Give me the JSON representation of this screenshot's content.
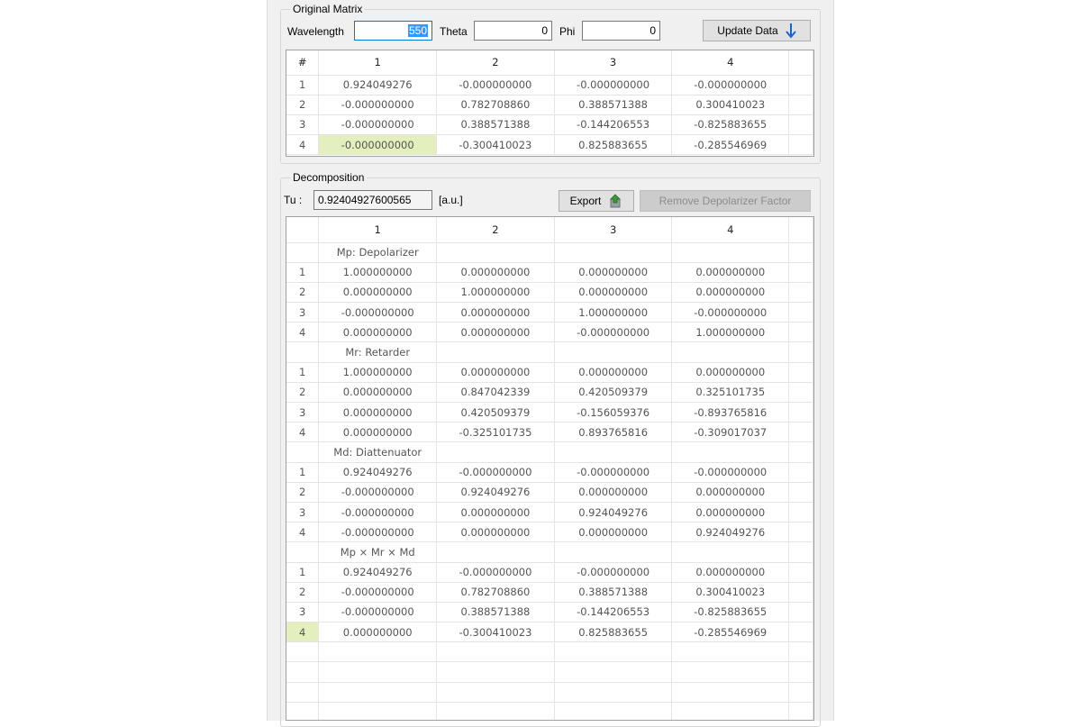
{
  "original": {
    "group_title": "Original Matrix",
    "wavelength_label": "Wavelength",
    "wavelength_value": "550",
    "theta_label": "Theta",
    "theta_value": "0",
    "phi_label": "Phi",
    "phi_value": "0",
    "update_label": "Update Data",
    "headers": [
      "#",
      "1",
      "2",
      "3",
      "4"
    ],
    "rows": [
      [
        "1",
        "0.924049276",
        "-0.000000000",
        "-0.000000000",
        "-0.000000000"
      ],
      [
        "2",
        "-0.000000000",
        "0.782708860",
        "0.388571388",
        "0.300410023"
      ],
      [
        "3",
        "-0.000000000",
        "0.388571388",
        "-0.144206553",
        "-0.825883655"
      ],
      [
        "4",
        "-0.000000000",
        "-0.300410023",
        "0.825883655",
        "-0.285546969"
      ]
    ]
  },
  "decomp": {
    "group_title": "Decomposition",
    "tu_label": "Tu :",
    "tu_value": "0.92404927600565",
    "unit_label": "[a.u.]",
    "export_label": "Export",
    "remove_label": "Remove Depolarizer Factor",
    "headers": [
      "",
      "1",
      "2",
      "3",
      "4"
    ],
    "sections": [
      {
        "title": "Mp: Depolarizer",
        "rows": [
          [
            "1",
            "1.000000000",
            "0.000000000",
            "0.000000000",
            "0.000000000"
          ],
          [
            "2",
            "0.000000000",
            "1.000000000",
            "0.000000000",
            "0.000000000"
          ],
          [
            "3",
            "-0.000000000",
            "0.000000000",
            "1.000000000",
            "-0.000000000"
          ],
          [
            "4",
            "0.000000000",
            "0.000000000",
            "-0.000000000",
            "1.000000000"
          ]
        ]
      },
      {
        "title": "Mr: Retarder",
        "rows": [
          [
            "1",
            "1.000000000",
            "0.000000000",
            "0.000000000",
            "0.000000000"
          ],
          [
            "2",
            "0.000000000",
            "0.847042339",
            "0.420509379",
            "0.325101735"
          ],
          [
            "3",
            "0.000000000",
            "0.420509379",
            "-0.156059376",
            "-0.893765816"
          ],
          [
            "4",
            "0.000000000",
            "-0.325101735",
            "0.893765816",
            "-0.309017037"
          ]
        ]
      },
      {
        "title": "Md: Diattenuator",
        "rows": [
          [
            "1",
            "0.924049276",
            "-0.000000000",
            "-0.000000000",
            "-0.000000000"
          ],
          [
            "2",
            "-0.000000000",
            "0.924049276",
            "0.000000000",
            "0.000000000"
          ],
          [
            "3",
            "-0.000000000",
            "0.000000000",
            "0.924049276",
            "0.000000000"
          ],
          [
            "4",
            "-0.000000000",
            "0.000000000",
            "0.000000000",
            "0.924049276"
          ]
        ]
      },
      {
        "title": "Mp × Mr × Md",
        "rows": [
          [
            "1",
            "0.924049276",
            "-0.000000000",
            "-0.000000000",
            "0.000000000"
          ],
          [
            "2",
            "-0.000000000",
            "0.782708860",
            "0.388571388",
            "0.300410023"
          ],
          [
            "3",
            "-0.000000000",
            "0.388571388",
            "-0.144206553",
            "-0.825883655"
          ],
          [
            "4",
            "0.000000000",
            "-0.300410023",
            "0.825883655",
            "-0.285546969"
          ]
        ]
      }
    ]
  },
  "colors": {
    "window_bg": "#f0f0f0",
    "selected_cell": "#e3efbd",
    "text_selection": "#3399ff",
    "arrow_blue": "#1e64c8",
    "export_icon_green": "#3a9a3a"
  },
  "icons": {
    "update": "down-arrow-icon",
    "export": "export-icon"
  }
}
